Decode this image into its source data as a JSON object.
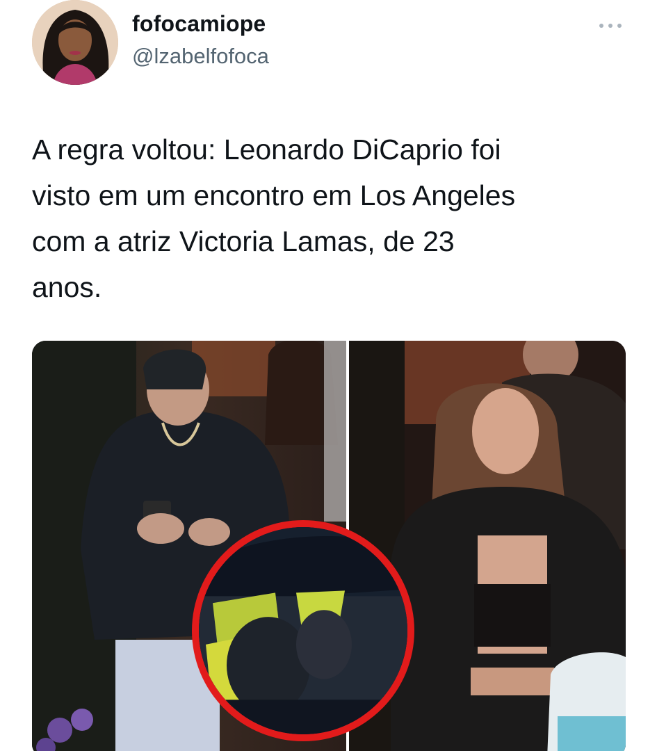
{
  "user": {
    "display_name": "fofocamiope",
    "handle": "@lzabelfofoca",
    "avatar_icon": "profile-photo"
  },
  "tweet": {
    "text": "A regra voltou: Leonardo DiCaprio foi\nvisto em um encontro em Los Angeles\ncom a atriz Victoria Lamas, de 23\nanos."
  },
  "media": {
    "photo_count": 2,
    "inset_highlight_color": "#e21b1b"
  },
  "icons": {
    "more": "more-options-icon"
  }
}
